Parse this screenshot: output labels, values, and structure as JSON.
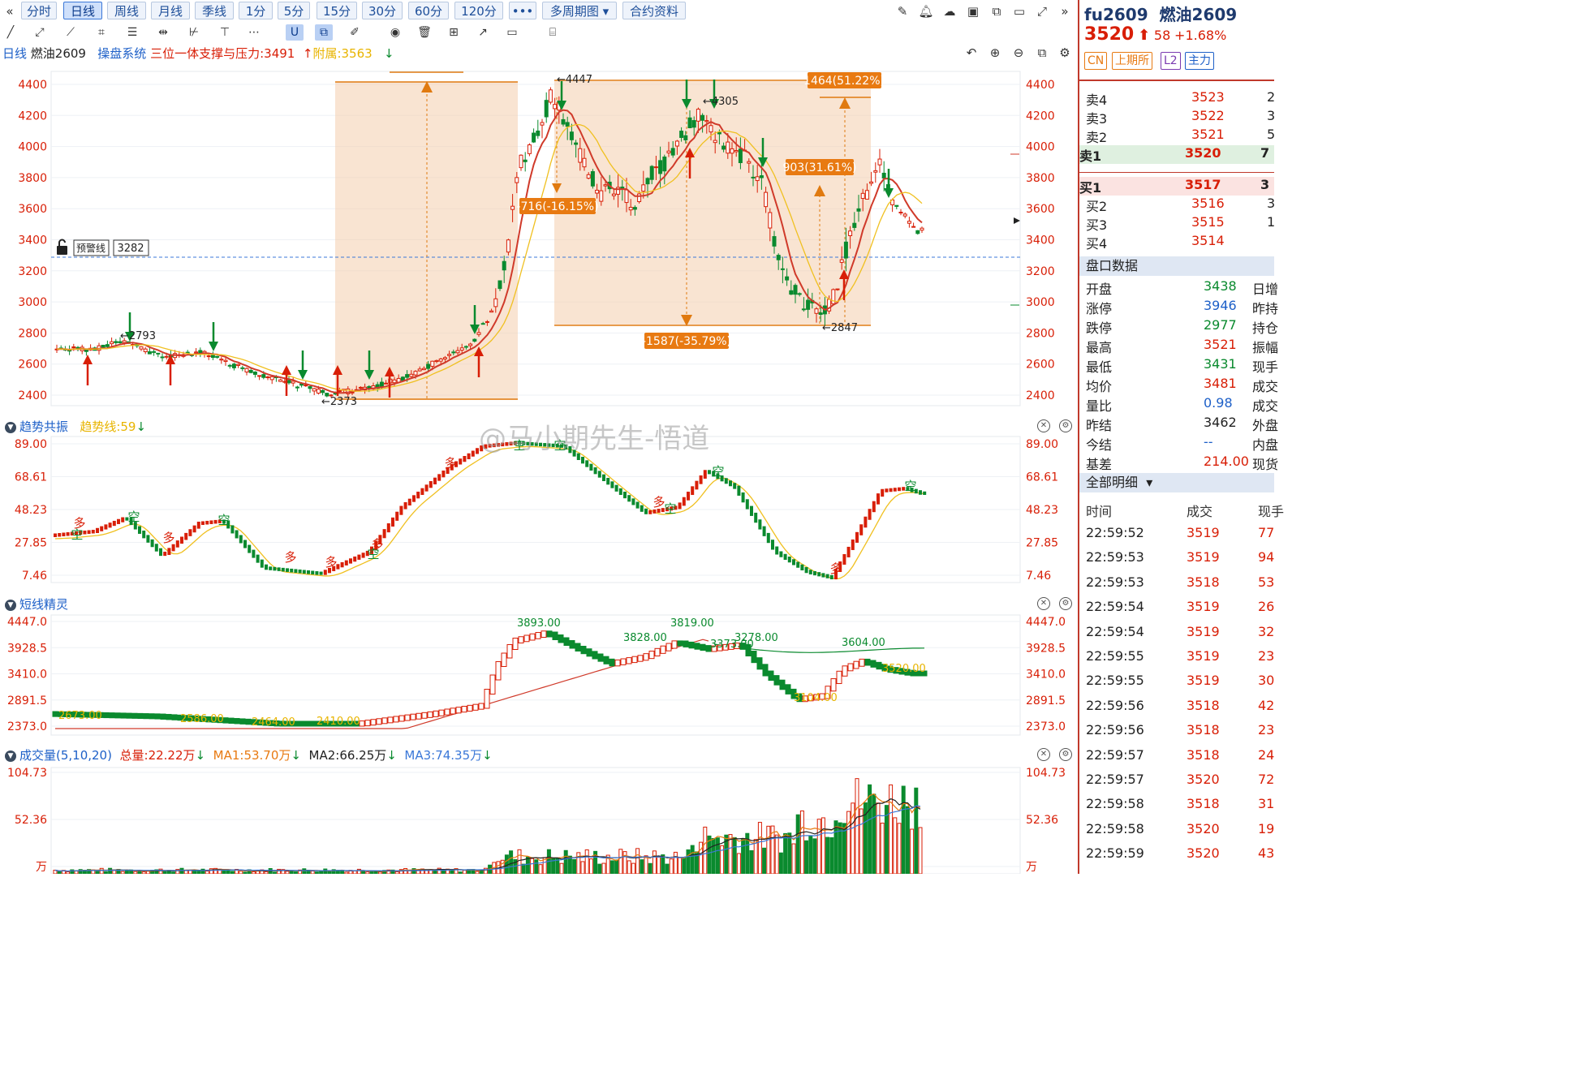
{
  "period_bar": {
    "buttons": [
      "分时",
      "日线",
      "周线",
      "月线",
      "季线",
      "1分",
      "5分",
      "15分",
      "30分",
      "60分",
      "120分"
    ],
    "active": "日线",
    "more": "•••",
    "multi_period": "多周期图",
    "contract_info": "合约资料"
  },
  "info_line": {
    "period": "日线",
    "name": "燃油2609",
    "system": "操盘系统",
    "support": "三位一体支撑与压力:3491",
    "attach": "附属:3563"
  },
  "warning": {
    "label": "预警线",
    "value": "3282"
  },
  "main_chart": {
    "y_ticks": [
      "4400",
      "4200",
      "4000",
      "3800",
      "3600",
      "3400",
      "3200",
      "3000",
      "2800",
      "2600",
      "2400"
    ],
    "annotations": {
      "high1": "←4447",
      "high2": "←4305",
      "low1": "←2373",
      "low2": "←2847",
      "mark1": "←2793",
      "box_up": "1464(51.22%)",
      "box_mid": "903(31.61%)",
      "box_down1": "-716(-16.15%)",
      "box_down2": "-1587(-35.79%)"
    }
  },
  "trend_panel": {
    "title": "趋势共振",
    "line_label": "趋势线:59",
    "y_ticks": [
      "89.00",
      "68.61",
      "48.23",
      "27.85",
      "7.46"
    ],
    "tags": {
      "bull": "多",
      "bear": "空"
    }
  },
  "short_panel": {
    "title": "短线精灵",
    "y_ticks": [
      "4447.0",
      "3928.5",
      "3410.0",
      "2891.5",
      "2373.0"
    ],
    "labels": [
      "3893.00",
      "3828.00",
      "3819.00",
      "3604.00",
      "3520.00",
      "3373.00",
      "3278.00",
      "3104.00",
      "2673.00",
      "2586.00",
      "2464.00",
      "2410.00"
    ]
  },
  "volume_panel": {
    "title": "成交量(5,10,20)",
    "total": "总量:22.22万",
    "ma1": "MA1:53.70万",
    "ma2": "MA2:66.25万",
    "ma3": "MA3:74.35万",
    "y_ticks": [
      "104.73",
      "52.36",
      "万"
    ]
  },
  "watermark": "@马小期先生-悟道",
  "quote": {
    "code": "fu2609",
    "name": "燃油2609",
    "price": "3520",
    "change": "58",
    "change_pct": "+1.68%",
    "tags": [
      "CN",
      "上期所",
      "L2",
      "主力"
    ],
    "asks": [
      {
        "label": "卖4",
        "price": "3523",
        "vol": "2"
      },
      {
        "label": "卖3",
        "price": "3522",
        "vol": "3"
      },
      {
        "label": "卖2",
        "price": "3521",
        "vol": "5"
      },
      {
        "label": "卖1",
        "price": "3520",
        "vol": "7"
      }
    ],
    "bids": [
      {
        "label": "买1",
        "price": "3517",
        "vol": "3"
      },
      {
        "label": "买2",
        "price": "3516",
        "vol": "3"
      },
      {
        "label": "买3",
        "price": "3515",
        "vol": "1"
      },
      {
        "label": "买4",
        "price": "3514",
        "vol": ""
      }
    ],
    "stats_title": "盘口数据",
    "stats": [
      {
        "label": "开盘",
        "value": "3438",
        "color": "green",
        "side": "日增"
      },
      {
        "label": "涨停",
        "value": "3946",
        "color": "blue",
        "side": "昨持"
      },
      {
        "label": "跌停",
        "value": "2977",
        "color": "green",
        "side": "持仓"
      },
      {
        "label": "最高",
        "value": "3521",
        "color": "red",
        "side": "振幅"
      },
      {
        "label": "最低",
        "value": "3431",
        "color": "green",
        "side": "现手"
      },
      {
        "label": "均价",
        "value": "3481",
        "color": "red",
        "side": "成交"
      },
      {
        "label": "量比",
        "value": "0.98",
        "color": "blue",
        "side": "成交"
      },
      {
        "label": "昨结",
        "value": "3462",
        "color": "black",
        "side": "外盘"
      },
      {
        "label": "今结",
        "value": "--",
        "color": "blue",
        "side": "内盘"
      },
      {
        "label": "基差",
        "value": "214.00",
        "color": "red",
        "side": "现货"
      }
    ],
    "ticks_title": "全部明细",
    "ticks_headers": [
      "时间",
      "成交",
      "现手"
    ],
    "ticks": [
      {
        "time": "22:59:52",
        "price": "3519",
        "vol": "77"
      },
      {
        "time": "22:59:53",
        "price": "3519",
        "vol": "94"
      },
      {
        "time": "22:59:53",
        "price": "3518",
        "vol": "53"
      },
      {
        "time": "22:59:54",
        "price": "3519",
        "vol": "26"
      },
      {
        "time": "22:59:54",
        "price": "3519",
        "vol": "32"
      },
      {
        "time": "22:59:55",
        "price": "3519",
        "vol": "23"
      },
      {
        "time": "22:59:55",
        "price": "3519",
        "vol": "30"
      },
      {
        "time": "22:59:56",
        "price": "3518",
        "vol": "42"
      },
      {
        "time": "22:59:56",
        "price": "3518",
        "vol": "23"
      },
      {
        "time": "22:59:57",
        "price": "3518",
        "vol": "24"
      },
      {
        "time": "22:59:57",
        "price": "3520",
        "vol": "72"
      },
      {
        "time": "22:59:58",
        "price": "3518",
        "vol": "31"
      },
      {
        "time": "22:59:58",
        "price": "3520",
        "vol": "19"
      },
      {
        "time": "22:59:59",
        "price": "3520",
        "vol": "43"
      }
    ]
  }
}
